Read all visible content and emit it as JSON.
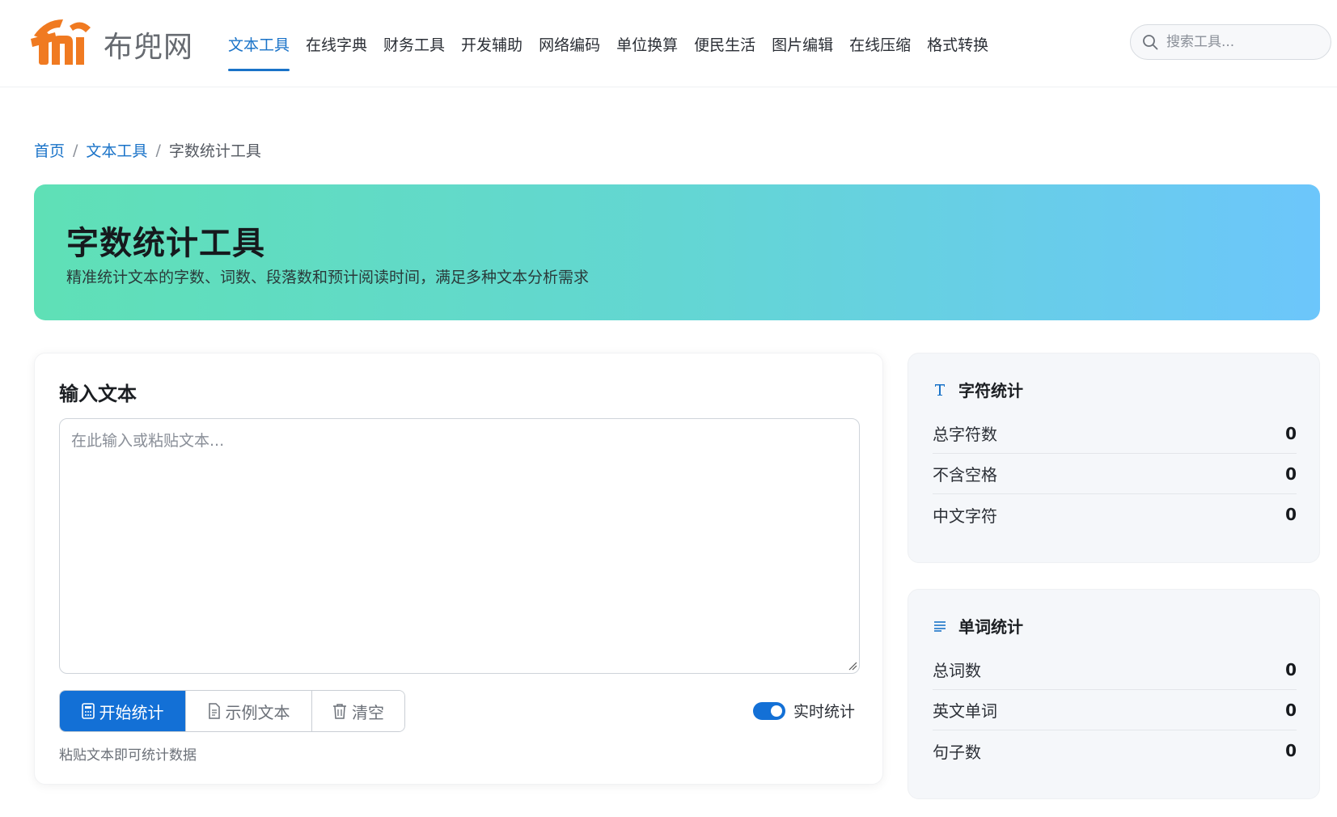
{
  "brand": {
    "name": "布兜网",
    "accent": "#f07a21"
  },
  "nav": {
    "items": [
      {
        "label": "文本工具",
        "active": true
      },
      {
        "label": "在线字典"
      },
      {
        "label": "财务工具"
      },
      {
        "label": "开发辅助"
      },
      {
        "label": "网络编码"
      },
      {
        "label": "单位换算"
      },
      {
        "label": "便民生活"
      },
      {
        "label": "图片编辑"
      },
      {
        "label": "在线压缩"
      },
      {
        "label": "格式转换"
      }
    ]
  },
  "search": {
    "placeholder": "搜索工具..."
  },
  "breadcrumb": {
    "home": "首页",
    "category": "文本工具",
    "current": "字数统计工具",
    "sep": "/"
  },
  "banner": {
    "title": "字数统计工具",
    "subtitle": "精准统计文本的字数、词数、段落数和预计阅读时间，满足多种文本分析需求"
  },
  "input": {
    "title": "输入文本",
    "placeholder": "在此输入或粘贴文本...",
    "value": "",
    "buttons": {
      "start": "开始统计",
      "sample": "示例文本",
      "clear": "清空"
    },
    "realtime_label": "实时统计",
    "realtime_on": true,
    "hint": "粘贴文本即可统计数据"
  },
  "char_stats": {
    "title": "字符统计",
    "rows": [
      {
        "label": "总字符数",
        "value": "0"
      },
      {
        "label": "不含空格",
        "value": "0"
      },
      {
        "label": "中文字符",
        "value": "0"
      }
    ]
  },
  "word_stats": {
    "title": "单词统计",
    "rows": [
      {
        "label": "总词数",
        "value": "0"
      },
      {
        "label": "英文单词",
        "value": "0"
      },
      {
        "label": "句子数",
        "value": "0"
      }
    ]
  },
  "colors": {
    "primary": "#1370d6",
    "link": "#1a73c8"
  }
}
